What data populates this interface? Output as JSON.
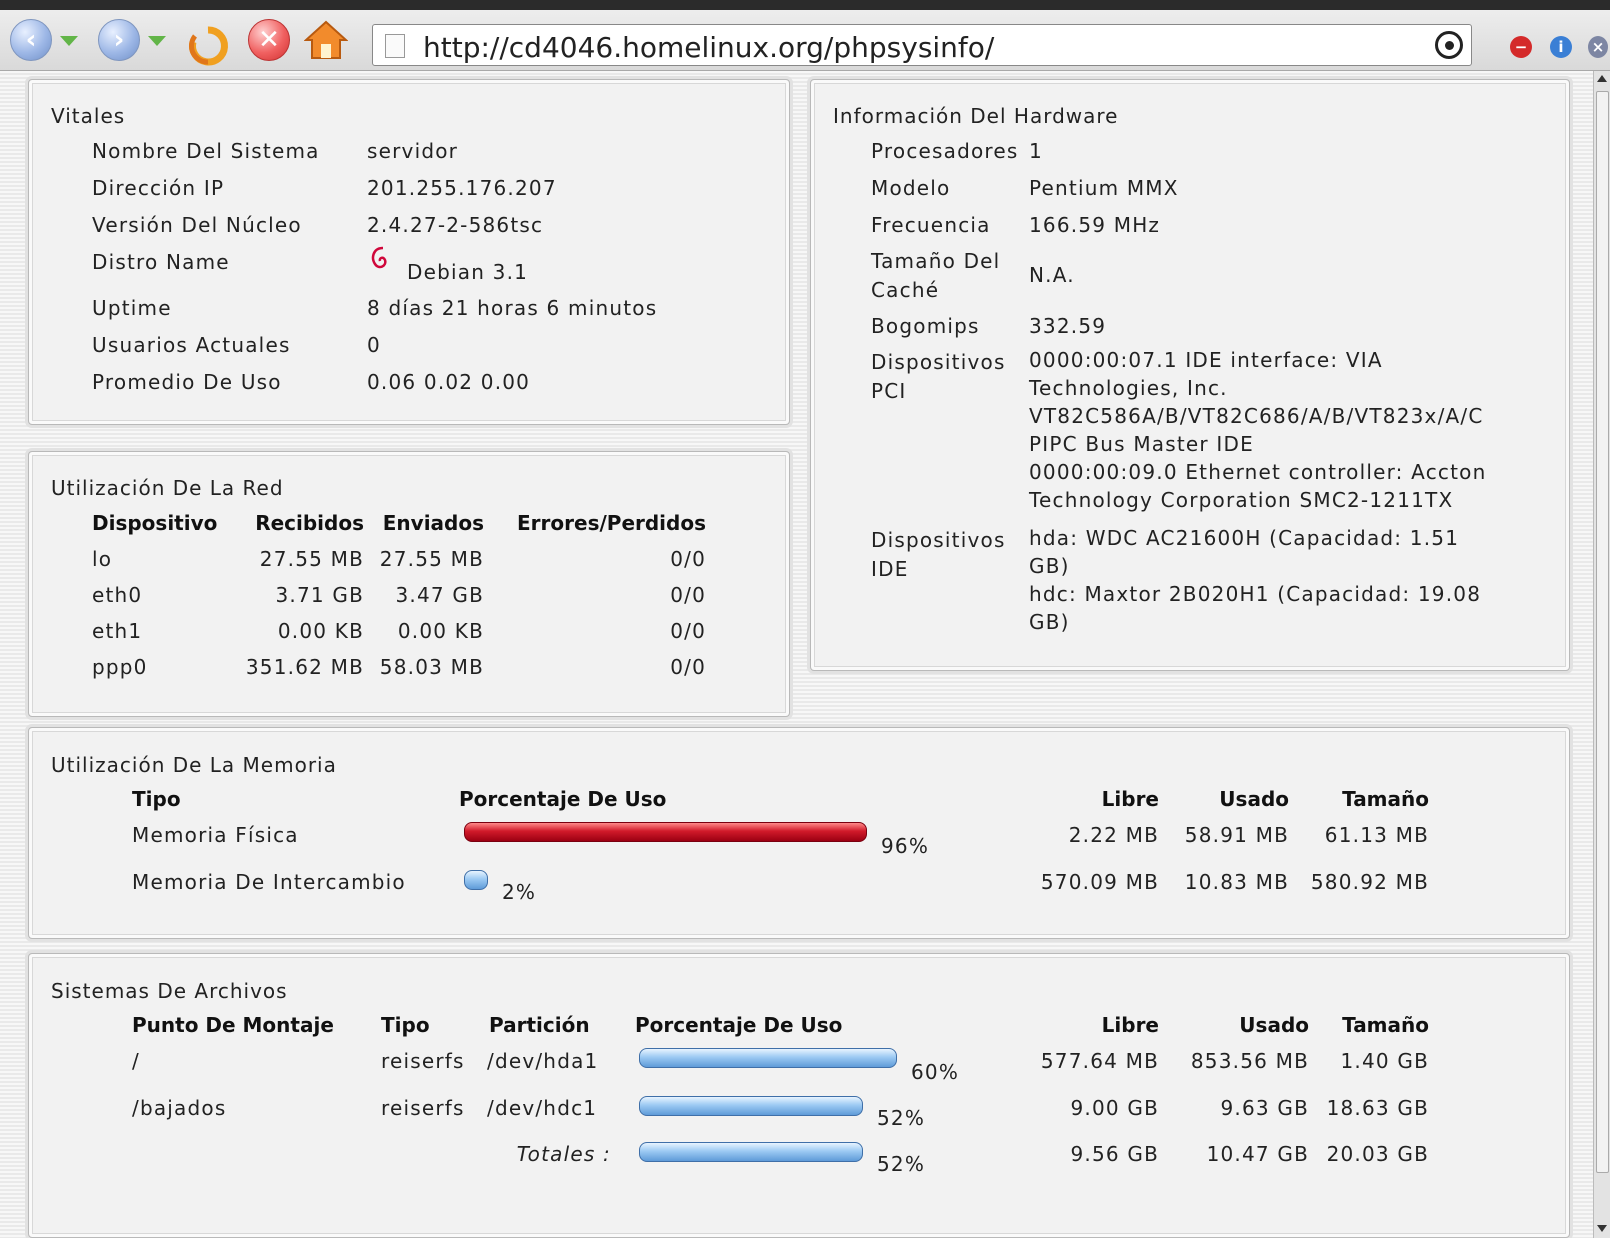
{
  "browser": {
    "url": "http://cd4046.homelinux.org/phpsysinfo/",
    "icons": [
      "back-icon",
      "forward-icon",
      "reload-icon",
      "stop-icon",
      "home-icon",
      "document-icon",
      "go-icon",
      "red-stop-icon",
      "blue-info-icon",
      "close-icon"
    ]
  },
  "vitales": {
    "title": "Vitales",
    "rows": [
      {
        "label": "Nombre Del Sistema",
        "value": "servidor"
      },
      {
        "label": "Dirección IP",
        "value": "201.255.176.207"
      },
      {
        "label": "Versión Del Núcleo",
        "value": "2.4.27-2-586tsc"
      },
      {
        "label": "Distro Name",
        "value": "Debian 3.1"
      },
      {
        "label": "Uptime",
        "value": "8 días 21 horas 6 minutos"
      },
      {
        "label": "Usuarios Actuales",
        "value": "0"
      },
      {
        "label": "Promedio De Uso",
        "value": "0.06 0.02 0.00"
      }
    ]
  },
  "hardware": {
    "title": "Información Del Hardware",
    "procesadores_label": "Procesadores",
    "procesadores_value": "1",
    "modelo_label": "Modelo",
    "modelo_value": "Pentium MMX",
    "frecuencia_label": "Frecuencia",
    "frecuencia_value": "166.59 MHz",
    "cache_label_1": "Tamaño Del",
    "cache_label_2": "Caché",
    "cache_value": "N.A.",
    "bogomips_label": "Bogomips",
    "bogomips_value": "332.59",
    "pci_label_1": "Dispositivos",
    "pci_label_2": "PCI",
    "pci_lines": [
      "0000:00:07.1 IDE interface: VIA",
      "Technologies, Inc.",
      "VT82C586A/B/VT82C686/A/B/VT823x/A/C",
      "PIPC Bus Master IDE",
      "0000:00:09.0 Ethernet controller: Accton",
      "Technology Corporation SMC2-1211TX"
    ],
    "ide_label_1": "Dispositivos",
    "ide_label_2": "IDE",
    "ide_lines": [
      "hda: WDC AC21600H (Capacidad: 1.51",
      "GB)",
      "hdc: Maxtor 2B020H1 (Capacidad: 19.08",
      "GB)"
    ]
  },
  "red": {
    "title": "Utilización De La Red",
    "headers": [
      "Dispositivo",
      "Recibidos",
      "Enviados",
      "Errores/Perdidos"
    ],
    "rows": [
      {
        "dev": "lo",
        "rx": "27.55 MB",
        "tx": "27.55 MB",
        "err": "0/0"
      },
      {
        "dev": "eth0",
        "rx": "3.71 GB",
        "tx": "3.47 GB",
        "err": "0/0"
      },
      {
        "dev": "eth1",
        "rx": "0.00 KB",
        "tx": "0.00 KB",
        "err": "0/0"
      },
      {
        "dev": "ppp0",
        "rx": "351.62 MB",
        "tx": "58.03 MB",
        "err": "0/0"
      }
    ]
  },
  "memoria": {
    "title": "Utilización De La Memoria",
    "headers": [
      "Tipo",
      "Porcentaje De Uso",
      "Libre",
      "Usado",
      "Tamaño"
    ],
    "rows": [
      {
        "tipo": "Memoria Física",
        "pct": "96%",
        "fill": 0.96,
        "color": "#d11a2a",
        "libre": "2.22 MB",
        "usado": "58.91 MB",
        "tam": "61.13 MB"
      },
      {
        "tipo": "Memoria De Intercambio",
        "pct": "2%",
        "fill": 0.02,
        "color": "#8fc0ee",
        "libre": "570.09 MB",
        "usado": "10.83 MB",
        "tam": "580.92 MB"
      }
    ]
  },
  "archivos": {
    "title": "Sistemas De Archivos",
    "headers": [
      "Punto De Montaje",
      "Tipo",
      "Partición",
      "Porcentaje De Uso",
      "Libre",
      "Usado",
      "Tamaño"
    ],
    "rows": [
      {
        "punto": "/",
        "tipo": "reiserfs",
        "part": "/dev/hda1",
        "pct": "60%",
        "fill": 0.6,
        "libre": "577.64 MB",
        "usado": "853.56 MB",
        "tam": "1.40 GB"
      },
      {
        "punto": "/bajados",
        "tipo": "reiserfs",
        "part": "/dev/hdc1",
        "pct": "52%",
        "fill": 0.52,
        "libre": "9.00 GB",
        "usado": "9.63 GB",
        "tam": "18.63 GB"
      }
    ],
    "totales": {
      "label": "Totales :",
      "pct": "52%",
      "fill": 0.52,
      "libre": "9.56 GB",
      "usado": "10.47 GB",
      "tam": "20.03 GB"
    }
  }
}
